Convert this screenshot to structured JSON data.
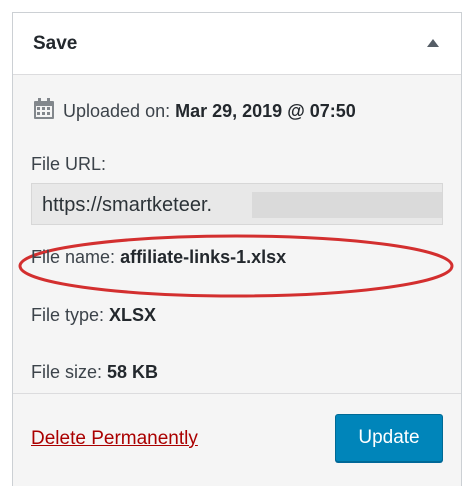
{
  "panel": {
    "title": "Save"
  },
  "meta": {
    "uploaded_label": "Uploaded on:",
    "uploaded_value": "Mar 29, 2019 @ 07:50",
    "file_url_label": "File URL:",
    "file_url_value": "https://smartketeer.",
    "file_name_label": "File name:",
    "file_name_value": "affiliate-links-1.xlsx",
    "file_type_label": "File type:",
    "file_type_value": "XLSX",
    "file_size_label": "File size:",
    "file_size_value": "58 KB"
  },
  "actions": {
    "delete_label": "Delete Permanently",
    "update_label": "Update"
  },
  "colors": {
    "primary_button": "#0085ba",
    "delete_link": "#a00",
    "annotation_circle": "#d32f2f"
  },
  "icons": {
    "calendar": "calendar-icon",
    "toggle": "triangle-up-icon"
  }
}
